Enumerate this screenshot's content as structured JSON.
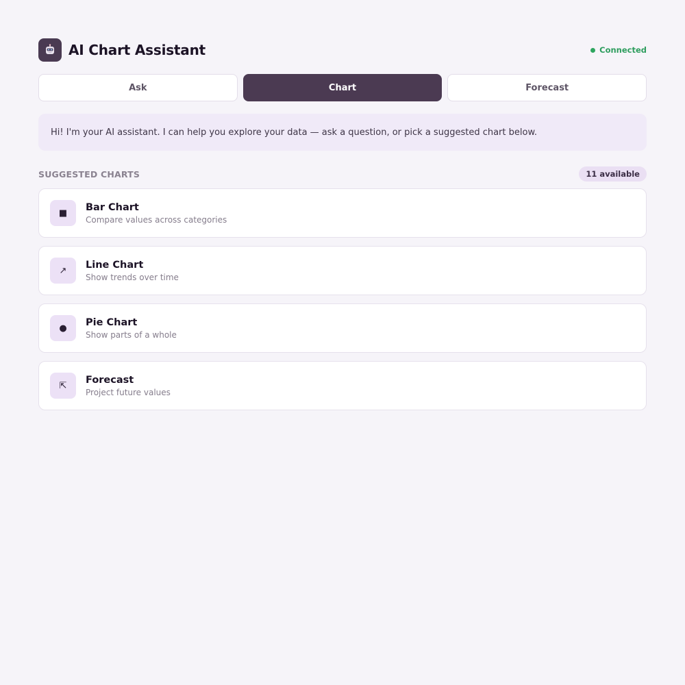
{
  "header": {
    "title": "AI Chart Assistant",
    "logo_icon": "robot-icon",
    "status": {
      "label": "Connected",
      "color": "#2ea55f"
    }
  },
  "tabs": [
    {
      "label": "Ask",
      "active": false
    },
    {
      "label": "Chart",
      "active": true
    },
    {
      "label": "Forecast",
      "active": false
    }
  ],
  "greeting": "Hi! I'm your AI assistant. I can help you explore your data — ask a question, or pick a suggested chart below.",
  "suggested": {
    "heading": "SUGGESTED CHARTS",
    "count_label": "11 available",
    "items": [
      {
        "title": "Bar Chart",
        "subtitle": "Compare values across categories",
        "icon": "bar-chart-icon",
        "glyph": "■"
      },
      {
        "title": "Line Chart",
        "subtitle": "Show trends over time",
        "icon": "line-chart-icon",
        "glyph": "↗"
      },
      {
        "title": "Pie Chart",
        "subtitle": "Show parts of a whole",
        "icon": "pie-chart-icon",
        "glyph": "●"
      },
      {
        "title": "Forecast",
        "subtitle": "Project future values",
        "icon": "forecast-icon",
        "glyph": "⇱"
      }
    ]
  },
  "colors": {
    "accent": "#4b3a52",
    "background": "#f6f4f9",
    "success": "#2ea55f",
    "icon_bg": "#ece1f6"
  }
}
